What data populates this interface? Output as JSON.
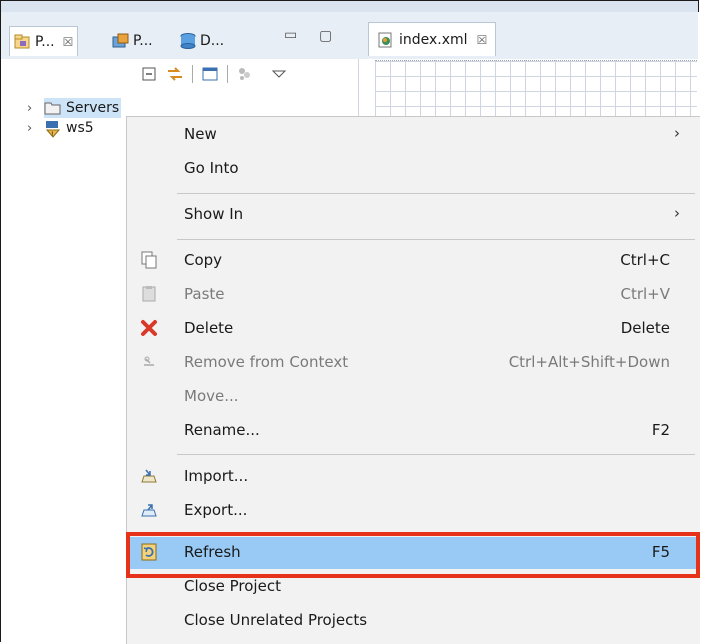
{
  "left_view": {
    "tabs": [
      {
        "label": "P...",
        "close": "☒",
        "icon": "package-explorer-icon"
      },
      {
        "label": "P...",
        "icon": "project-explorer-icon"
      },
      {
        "label": "D...",
        "icon": "database-icon"
      }
    ],
    "minimize": "▭",
    "maximize": "▢",
    "toolbar_icons": [
      "collapse-all-icon",
      "link-with-editor-icon",
      "focus-icon",
      "filter-icon",
      "view-menu-icon"
    ]
  },
  "tree": {
    "items": [
      {
        "label": "Servers",
        "icon": "folder-icon",
        "selected": true
      },
      {
        "label": "ws5",
        "icon": "web-project-icon"
      }
    ]
  },
  "editor": {
    "tab_label": "index.xml",
    "tab_close": "☒"
  },
  "context_menu": {
    "items": [
      {
        "label": "New",
        "submenu": "›"
      },
      {
        "label": "Go Into"
      },
      {
        "label": "Show In",
        "submenu": "›"
      },
      {
        "label": "Copy",
        "accel": "Ctrl+C",
        "icon": "copy-icon"
      },
      {
        "label": "Paste",
        "accel": "Ctrl+V",
        "icon": "paste-icon",
        "disabled": true
      },
      {
        "label": "Delete",
        "accel": "Delete",
        "icon": "delete-icon"
      },
      {
        "label": "Remove from Context",
        "accel": "Ctrl+Alt+Shift+Down",
        "icon": "remove-context-icon",
        "disabled": true
      },
      {
        "label": "Move...",
        "disabled": true
      },
      {
        "label": "Rename...",
        "accel": "F2"
      },
      {
        "label": "Import...",
        "icon": "import-icon"
      },
      {
        "label": "Export...",
        "icon": "export-icon"
      },
      {
        "label": "Refresh",
        "accel": "F5",
        "icon": "refresh-icon",
        "highlighted": true
      },
      {
        "label": "Close Project"
      },
      {
        "label": "Close Unrelated Projects"
      }
    ]
  },
  "colors": {
    "highlight_fill": "#99c9f5",
    "annotation_border": "#e53219",
    "selection_fill": "#cde3f7"
  }
}
